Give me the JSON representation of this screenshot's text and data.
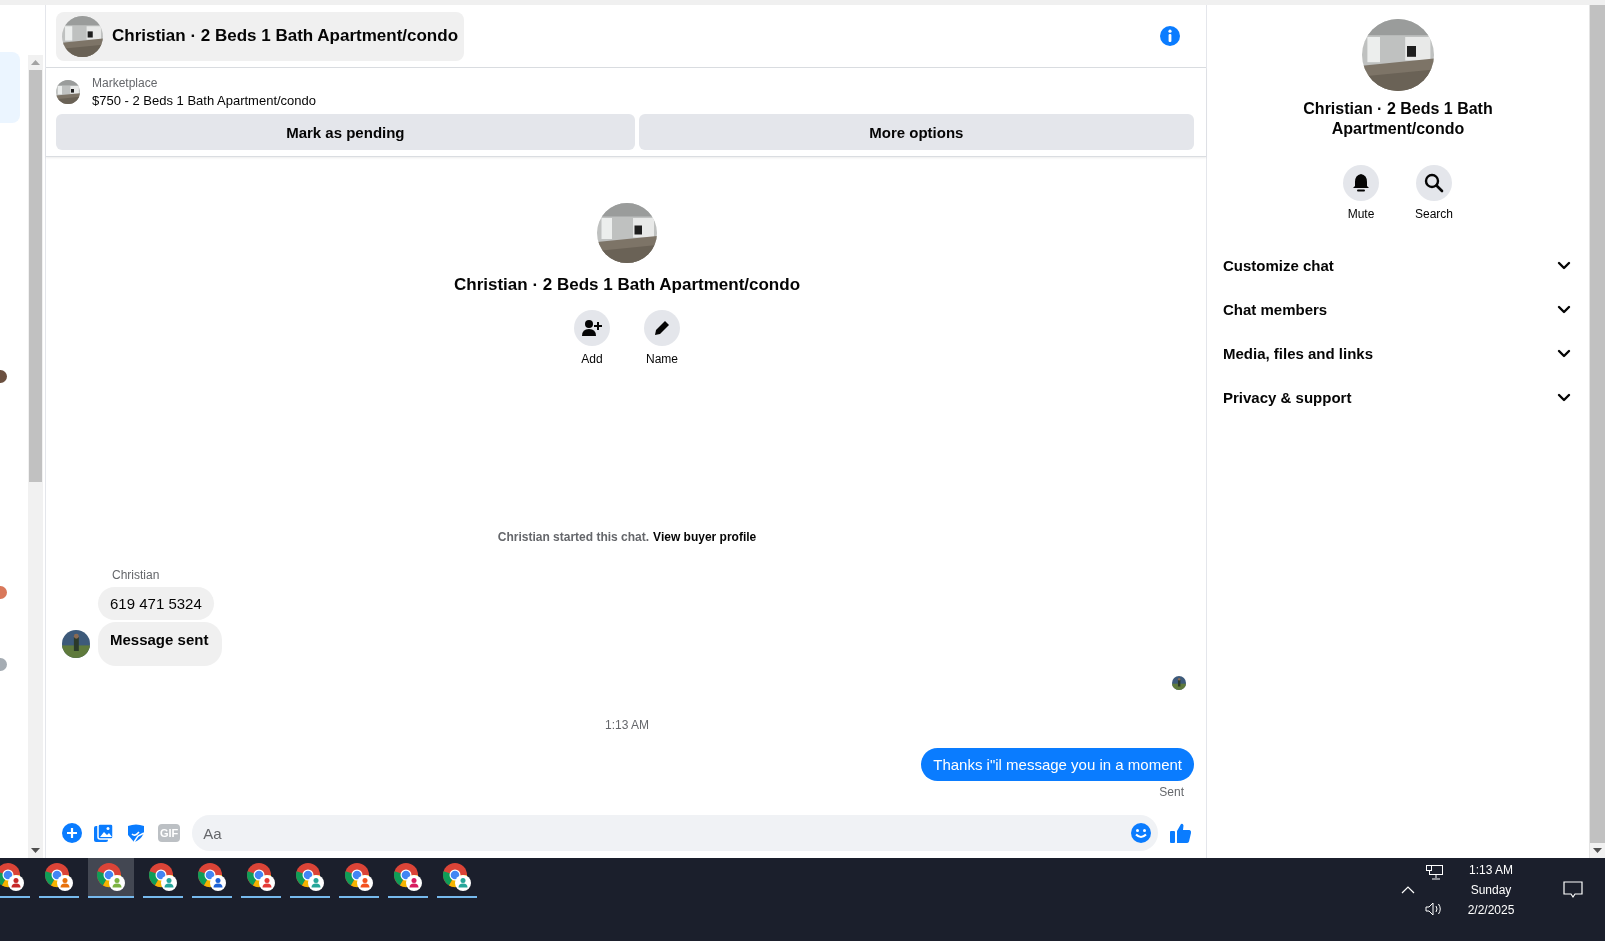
{
  "header": {
    "title": "Christian · 2 Beds 1 Bath Apartment/condo"
  },
  "listing": {
    "source": "Marketplace",
    "title": "$750 - 2 Beds 1 Bath Apartment/condo",
    "actions": [
      "Mark as pending",
      "More options"
    ]
  },
  "intro": {
    "title": "Christian · 2 Beds 1 Bath Apartment/condo",
    "actions": [
      {
        "label": "Add",
        "kind": "add-person"
      },
      {
        "label": "Name",
        "kind": "pencil"
      }
    ]
  },
  "system_message": {
    "text": "Christian started this chat.",
    "link": "View buyer profile"
  },
  "incoming": {
    "sender": "Christian",
    "bubbles": [
      {
        "text": "619 471 5324",
        "emphasis": false
      },
      {
        "text": "Message sent",
        "emphasis": true
      }
    ]
  },
  "timestamp": "1:13 AM",
  "outgoing": {
    "text": "Thanks i\"il message you in a moment",
    "status": "Sent"
  },
  "composer": {
    "gif_label": "GIF",
    "placeholder": "Aa"
  },
  "details": {
    "title": "Christian · 2 Beds 1 Bath Apartment/condo",
    "actions": [
      {
        "label": "Mute",
        "kind": "bell"
      },
      {
        "label": "Search",
        "kind": "search"
      }
    ],
    "sections": [
      {
        "label": "Customize chat",
        "expanded": false
      },
      {
        "label": "Chat members",
        "expanded": false
      },
      {
        "label": "Media, files and links",
        "expanded": false
      },
      {
        "label": "Privacy & support",
        "expanded": false
      }
    ]
  },
  "taskbar": {
    "apps": [
      {
        "color": "#c62828",
        "selected": false
      },
      {
        "color": "#e8710a",
        "selected": false
      },
      {
        "color": "#7cb342",
        "selected": true
      },
      {
        "color": "#26a69a",
        "selected": false
      },
      {
        "color": "#1e63d6",
        "selected": false
      },
      {
        "color": "#e53935",
        "selected": false
      },
      {
        "color": "#26a69a",
        "selected": false
      },
      {
        "color": "#f4511e",
        "selected": false
      },
      {
        "color": "#d81b60",
        "selected": false
      },
      {
        "color": "#26a69a",
        "selected": false
      }
    ],
    "clock": {
      "time": "1:13 AM",
      "day": "Sunday",
      "date": "2/2/2025"
    }
  }
}
